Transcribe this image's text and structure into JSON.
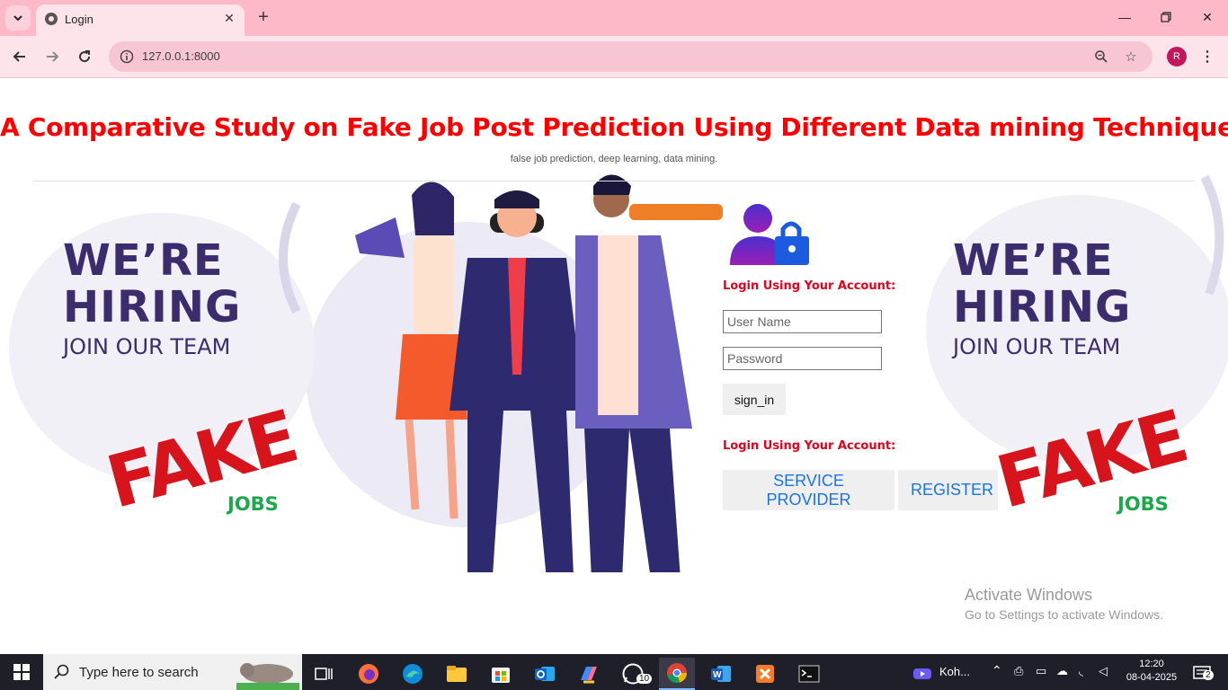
{
  "browser": {
    "tab_title": "Login",
    "url": "127.0.0.1:8000",
    "profile_initial": "R"
  },
  "page": {
    "title": "A Comparative Study on Fake Job Post Prediction Using Different Data mining Techniques",
    "subtitle": "false job prediction, deep learning, data mining.",
    "left_poster": {
      "line1": "WE’RE",
      "line2": "HIRING",
      "line3": "JOIN OUR TEAM",
      "stamp": "FAKE",
      "jobs": "JOBS"
    },
    "right_poster": {
      "line1": "WE’RE",
      "line2": "HIRING",
      "line3": "JOIN OUR TEAM",
      "stamp": "FAKE",
      "jobs": "JOBS"
    },
    "login": {
      "heading": "Login Using Your Account:",
      "username_placeholder": "User Name",
      "password_placeholder": "Password",
      "signin_label": "sign_in",
      "heading2": "Login Using Your Account:",
      "service_provider_label": "SERVICE PROVIDER",
      "register_label": "REGISTER"
    },
    "watermark": {
      "line1": "Activate Windows",
      "line2": "Go to Settings to activate Windows."
    }
  },
  "taskbar": {
    "search_placeholder": "Type here to search",
    "whatsapp_badge": "10",
    "zoom_label": "Koh...",
    "time": "12:20",
    "date": "08-04-2025",
    "notification_count": "2"
  },
  "colors": {
    "title_red": "#ff0000",
    "tab_strip_pink": "#fdb9c8",
    "link_blue": "#1a73e8",
    "poster_purple": "#3b2c6e",
    "jobs_green": "#1aa84a"
  }
}
